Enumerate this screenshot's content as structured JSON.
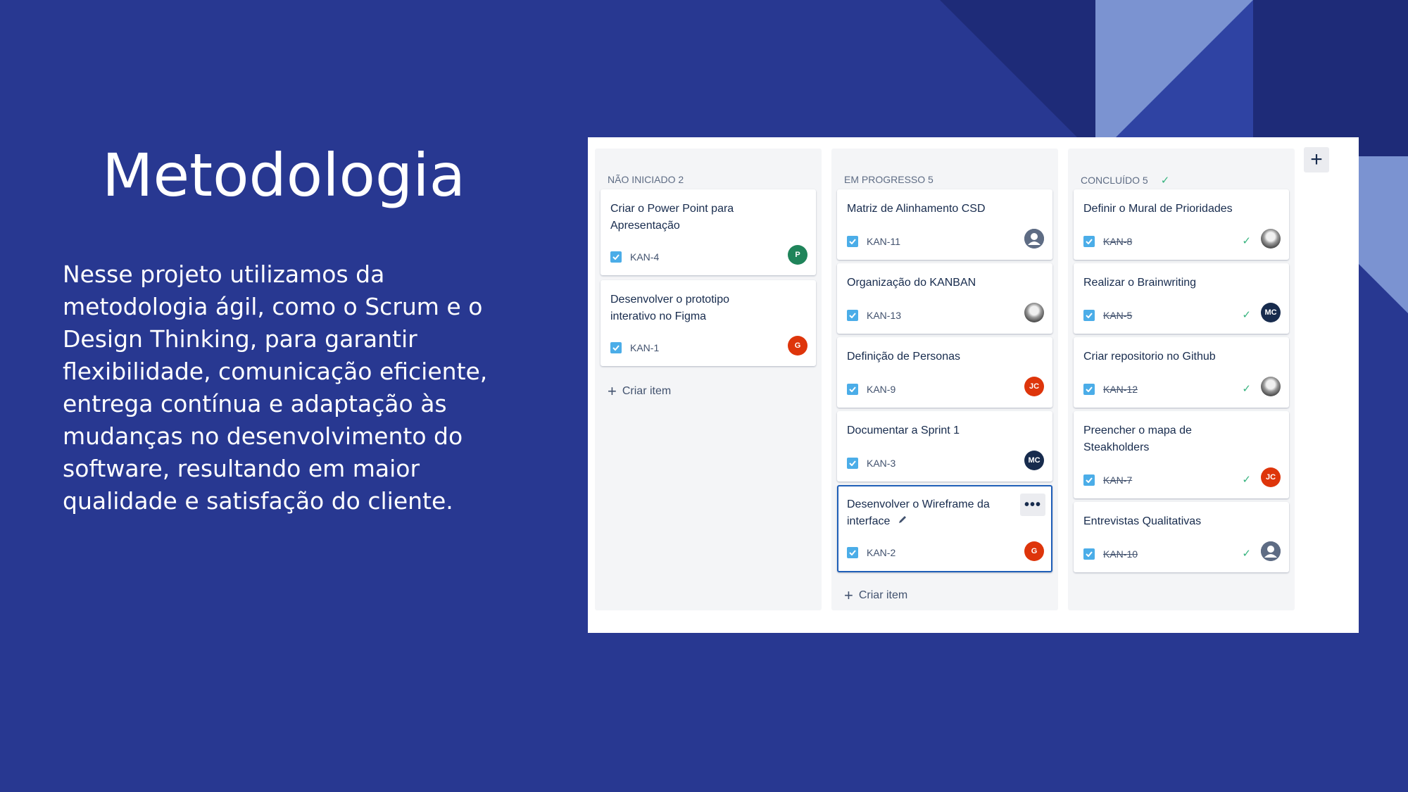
{
  "slide": {
    "title": "Metodologia",
    "body": "Nesse projeto utilizamos da metodologia ágil, como o Scrum e o Design Thinking, para garantir flexibilidade, comunicação eficiente, entrega contínua e adaptação às mudanças no desenvolvimento do software, resultando em maior qualidade e satisfação do cliente."
  },
  "colors": {
    "background": "#283891",
    "accent_light": "#7b93d1",
    "accent_dark": "#1e2b78",
    "checkbox": "#4bade8",
    "done_check": "#36b37e"
  },
  "board": {
    "add_column_icon": "plus-icon",
    "columns": [
      {
        "header": "NÃO INICIADO 2",
        "create_label": "Criar item",
        "cards": [
          {
            "title": "Criar o Power Point para Apresentação",
            "key": "KAN-4",
            "avatar": "P",
            "avatar_color": "#1f845a"
          },
          {
            "title": "Desenvolver o prototipo interativo no Figma",
            "key": "KAN-1",
            "avatar": "G",
            "avatar_color": "#de350b"
          }
        ]
      },
      {
        "header": "EM PROGRESSO 5",
        "create_label": "Criar item",
        "cards": [
          {
            "title": "Matriz de Alinhamento CSD",
            "key": "KAN-11",
            "avatar": "",
            "avatar_icon": "user-placeholder-icon"
          },
          {
            "title": "Organização do KANBAN",
            "key": "KAN-13",
            "avatar": "",
            "avatar_icon": "user-photo-icon"
          },
          {
            "title": "Definição de Personas",
            "key": "KAN-9",
            "avatar": "JC",
            "avatar_color": "#de350b"
          },
          {
            "title": "Documentar a Sprint 1",
            "key": "KAN-3",
            "avatar": "MC",
            "avatar_color": "#172b4d"
          },
          {
            "title": "Desenvolver o Wireframe da interface",
            "key": "KAN-2",
            "avatar": "G",
            "avatar_color": "#de350b",
            "more_icon": "more-icon",
            "edit_icon": "pencil-icon"
          }
        ]
      },
      {
        "header": "CONCLUÍDO 5",
        "header_icon": "check-icon",
        "cards": [
          {
            "title": "Definir o Mural de Prioridades",
            "key": "KAN-8",
            "avatar": "",
            "avatar_icon": "user-photo-icon"
          },
          {
            "title": "Realizar o Brainwriting",
            "key": "KAN-5",
            "avatar": "MC",
            "avatar_color": "#172b4d"
          },
          {
            "title": "Criar repositorio no Github",
            "key": "KAN-12",
            "avatar": "",
            "avatar_icon": "user-photo-icon"
          },
          {
            "title": "Preencher o mapa de Steakholders",
            "key": "KAN-7",
            "avatar": "JC",
            "avatar_color": "#de350b"
          },
          {
            "title": "Entrevistas Qualitativas",
            "key": "KAN-10",
            "avatar": "",
            "avatar_icon": "user-placeholder-icon"
          }
        ]
      }
    ]
  }
}
